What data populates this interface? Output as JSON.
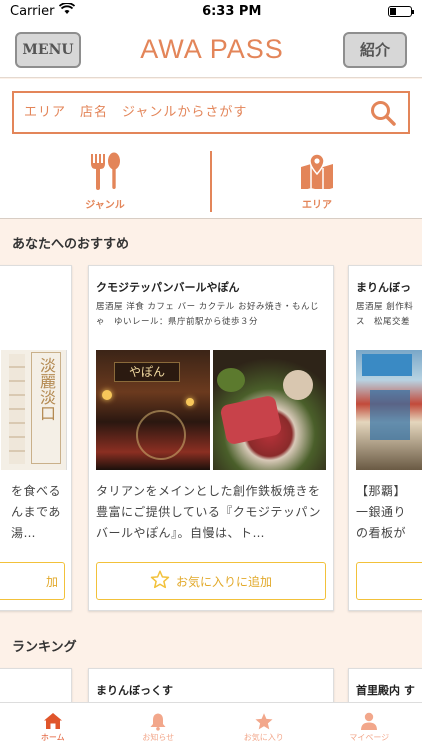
{
  "status": {
    "carrier": "Carrier",
    "time": "6:33 PM"
  },
  "header": {
    "menu_label": "MENU",
    "title": "AWA PASS",
    "intro_label": "紹介"
  },
  "search": {
    "placeholder": "エリア　店名　ジャンルからさがす"
  },
  "categories": [
    {
      "label": "ジャンル",
      "icon": "fork-spoon-icon"
    },
    {
      "label": "エリア",
      "icon": "map-pin-icon"
    }
  ],
  "recommend": {
    "title": "あなたへのおすすめ",
    "cards": [
      {
        "name": "",
        "tags": "",
        "desc": "を食べる\nんまであ\n湯…",
        "fav_label": "加"
      },
      {
        "name": "クモジテッパンバールやぽん",
        "tags": "居酒屋 洋食 カフェ バー カクテル お好み焼き・もんじゃ　ゆいレール：県庁前駅から徒歩３分",
        "desc": "タリアンをメインとした創作鉄板焼きを豊富にご提供している『クモジテッパンバールやぽん』。自慢は、ト…",
        "fav_label": "お気に入りに追加"
      },
      {
        "name": "まりんぼっ",
        "tags": "居酒屋 創作料\nス　松尾交差",
        "desc": "【那覇】\n一銀通り\nの看板が",
        "fav_label": ""
      }
    ]
  },
  "photo_text": {
    "sign": "やぽん",
    "banner": "淡麗淡口"
  },
  "ranking": {
    "title": "ランキング",
    "cards": [
      {
        "name": ""
      },
      {
        "name": "まりんぼっくす"
      },
      {
        "name": "首里殿内 す"
      }
    ]
  },
  "tabs": [
    {
      "label": "ホーム",
      "icon": "home-icon",
      "active": true
    },
    {
      "label": "お知らせ",
      "icon": "bell-icon",
      "active": false
    },
    {
      "label": "お気に入り",
      "icon": "star-icon",
      "active": false
    },
    {
      "label": "マイページ",
      "icon": "person-icon",
      "active": false
    }
  ],
  "colors": {
    "accent": "#e38559",
    "star": "#f2c13a",
    "background": "#fdf1e8"
  }
}
